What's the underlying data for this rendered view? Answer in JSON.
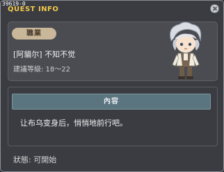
{
  "window": {
    "quest_id": "39619-0",
    "title": "QUEST INFO"
  },
  "job": {
    "badge": "職業",
    "name": "[阿貓尔] 不知不觉",
    "level_req": "建議等級: 18～22"
  },
  "content": {
    "header": "內容",
    "text": "让布乌变身后，悄悄地前行吧。"
  },
  "status": {
    "text": "狀態: 可開始"
  },
  "colors": {
    "title": "#f2c94c",
    "badge_bg": "#c9b79a",
    "content_header_bg": "#5b7580"
  }
}
